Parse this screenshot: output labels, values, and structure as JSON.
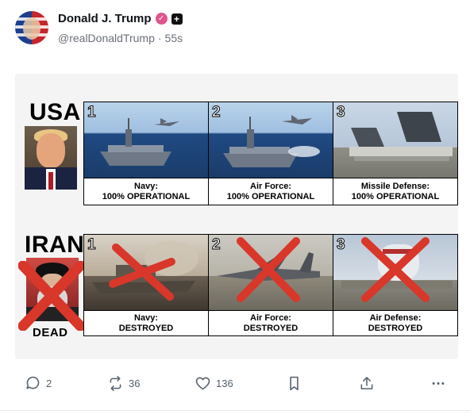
{
  "author": {
    "display_name": "Donald J. Trump",
    "handle": "@realDonaldTrump",
    "separator": "·",
    "time_ago": "55s"
  },
  "media": {
    "usa": {
      "label": "USA",
      "panels": [
        {
          "number": "1",
          "line1": "Navy:",
          "line2": "100% OPERATIONAL"
        },
        {
          "number": "2",
          "line1": "Air Force:",
          "line2": "100% OPERATIONAL"
        },
        {
          "number": "3",
          "line1": "Missile Defense:",
          "line2": "100% OPERATIONAL"
        }
      ]
    },
    "iran": {
      "label": "IRAN",
      "dead_label": "DEAD",
      "panels": [
        {
          "number": "1",
          "line1": "Navy:",
          "line2": "DESTROYED"
        },
        {
          "number": "2",
          "line1": "Air Force:",
          "line2": "DESTROYED"
        },
        {
          "number": "3",
          "line1": "Air Defense:",
          "line2": "DESTROYED"
        }
      ]
    },
    "cross_color": "#d8372a"
  },
  "actions": {
    "replies": "2",
    "reposts": "36",
    "likes": "136"
  },
  "icons": [
    "verified-badge-icon",
    "plus-badge-icon",
    "reply-icon",
    "repost-icon",
    "heart-icon",
    "bookmark-icon",
    "share-icon",
    "more-icon"
  ]
}
